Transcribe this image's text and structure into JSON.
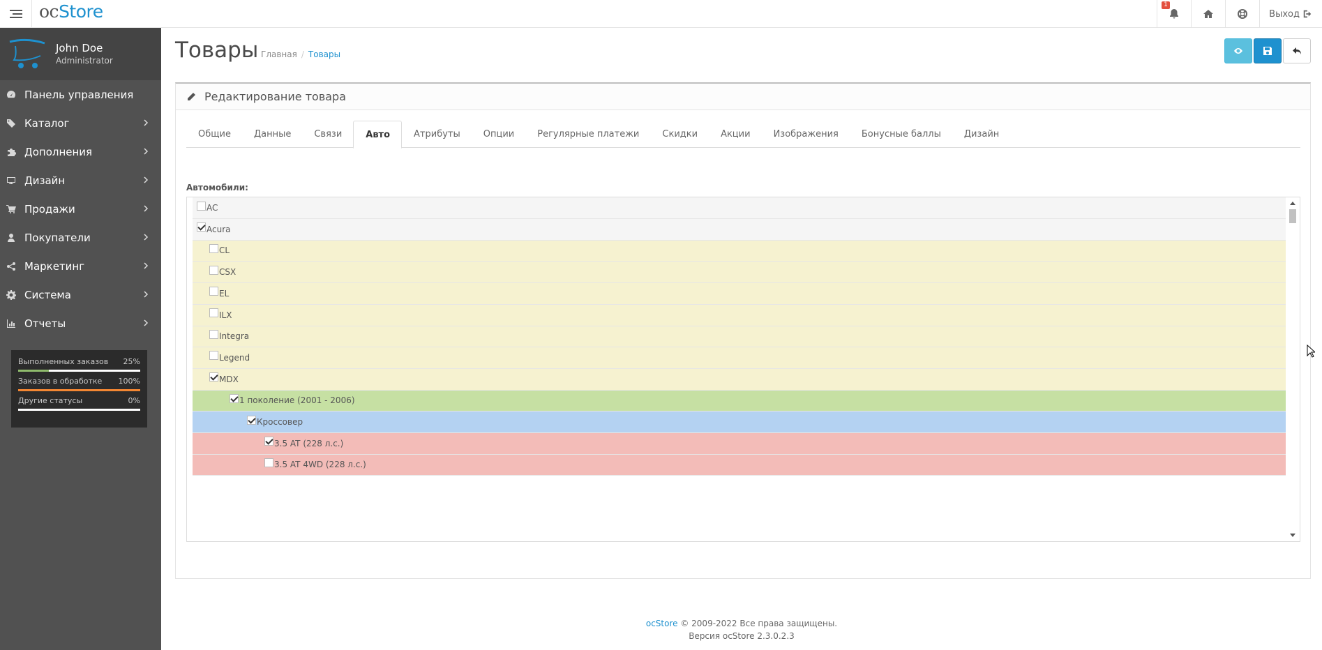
{
  "header": {
    "logo_oc": "oc",
    "logo_store": "Store",
    "notification_count": "1",
    "logout_label": "Выход"
  },
  "sidebar": {
    "user_name": "John Doe",
    "user_role": "Administrator",
    "menu": [
      {
        "label": "Панель управления",
        "icon": "dashboard-icon",
        "has_children": false
      },
      {
        "label": "Каталог",
        "icon": "tag-icon",
        "has_children": true
      },
      {
        "label": "Дополнения",
        "icon": "puzzle-icon",
        "has_children": true
      },
      {
        "label": "Дизайн",
        "icon": "desktop-icon",
        "has_children": true
      },
      {
        "label": "Продажи",
        "icon": "cart-icon",
        "has_children": true
      },
      {
        "label": "Покупатели",
        "icon": "user-icon",
        "has_children": true
      },
      {
        "label": "Маркетинг",
        "icon": "share-icon",
        "has_children": true
      },
      {
        "label": "Система",
        "icon": "cog-icon",
        "has_children": true
      },
      {
        "label": "Отчеты",
        "icon": "bar-chart-icon",
        "has_children": true
      }
    ],
    "stats": [
      {
        "label": "Выполненных заказов",
        "value": "25%",
        "fraction": 0.25,
        "color": "#8fbb6c"
      },
      {
        "label": "Заказов в обработке",
        "value": "100%",
        "fraction": 1.0,
        "color": "#f38733"
      },
      {
        "label": "Другие статусы",
        "value": "0%",
        "fraction": 0.0,
        "color": "#1e91cf"
      }
    ]
  },
  "page": {
    "title": "Товары",
    "breadcrumb_home": "Главная",
    "breadcrumb_sep": "/",
    "breadcrumb_current": "Товары",
    "panel_title": "Редактирование товара",
    "tabs": [
      "Общие",
      "Данные",
      "Связи",
      "Авто",
      "Атрибуты",
      "Опции",
      "Регулярные платежи",
      "Скидки",
      "Акции",
      "Изображения",
      "Бонусные баллы",
      "Дизайн"
    ],
    "active_tab": "Авто",
    "cars_label": "Автомобили:"
  },
  "tree": [
    {
      "label": "AC",
      "level": 0,
      "checked": false
    },
    {
      "label": "Acura",
      "level": 0,
      "checked": true
    },
    {
      "label": "CL",
      "level": 1,
      "checked": false
    },
    {
      "label": "CSX",
      "level": 1,
      "checked": false
    },
    {
      "label": "EL",
      "level": 1,
      "checked": false
    },
    {
      "label": "ILX",
      "level": 1,
      "checked": false
    },
    {
      "label": "Integra",
      "level": 1,
      "checked": false
    },
    {
      "label": "Legend",
      "level": 1,
      "checked": false
    },
    {
      "label": "MDX",
      "level": 1,
      "checked": true
    },
    {
      "label": "1 поколение (2001 - 2006)",
      "level": 2,
      "checked": true
    },
    {
      "label": "Кроссовер",
      "level": 3,
      "checked": true
    },
    {
      "label": "3.5 AT (228 л.с.)",
      "level": 4,
      "checked": true
    },
    {
      "label": "3.5 AT 4WD (228 л.с.)",
      "level": 4,
      "checked": false
    }
  ],
  "footer": {
    "brand": "ocStore",
    "copyright": "© 2009-2022 Все права защищены.",
    "version": "Версия ocStore 2.3.0.2.3"
  },
  "colors": {
    "accent": "#1e91cf",
    "sidebar_bg": "#515151",
    "level1": "#f6f2d0",
    "level2": "#c6e0a3",
    "level3": "#b4d2f2",
    "level4": "#f3bcb8"
  }
}
